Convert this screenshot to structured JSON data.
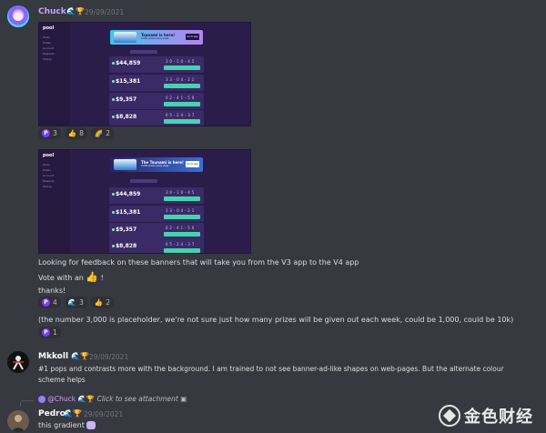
{
  "messages": [
    {
      "username": "Chuck",
      "username_color": "#c9a0ff",
      "badges": "🌊🏆",
      "timestamp": "29/09/2021",
      "screenshots": [
        {
          "app_logo": "pool",
          "nav_items": [
            "Pools",
            "Prizes",
            "Account",
            "Rewards",
            "Voting"
          ],
          "banner_title": "Tsunami is here!",
          "banner_subtitle": "3,000 prizes every week",
          "banner_button": "Go to app",
          "pools": [
            {
              "amount": "$44,859",
              "digits": "3 0 - 1 0 - 4 5"
            },
            {
              "amount": "$15,381",
              "digits": "3 3 - 0 4 - 2 1"
            },
            {
              "amount": "$9,357",
              "digits": "0 2 - 4 1 - 5 0"
            },
            {
              "amount": "$8,828",
              "digits": "0 5 - 2 4 - 3 7"
            }
          ]
        },
        {
          "app_logo": "pool",
          "nav_items": [
            "Pools",
            "Prizes",
            "Account",
            "Rewards",
            "Voting"
          ],
          "banner_title": "The Tsunami is here!",
          "banner_subtitle": "3,000 prizes every week",
          "banner_button": "Go to app",
          "pools": [
            {
              "amount": "$44,859",
              "digits": "3 0 - 1 0 - 4 5"
            },
            {
              "amount": "$15,381",
              "digits": "3 3 - 0 4 - 2 1"
            },
            {
              "amount": "$9,357",
              "digits": "0 2 - 4 1 - 5 0"
            },
            {
              "amount": "$8,828",
              "digits": "0 5 - 2 4 - 3 7"
            }
          ]
        }
      ],
      "reactions_top": [
        {
          "emoji": "P",
          "count": "3"
        },
        {
          "emoji": "👍",
          "count": "8"
        },
        {
          "emoji": "🌈",
          "count": "2"
        }
      ],
      "lines": [
        "Looking for feedback on these banners that will take you from the V3 app to the V4 app",
        "Vote with an",
        "thanks!"
      ],
      "vote_emoji": "👍",
      "vote_suffix": "!",
      "reactions_mid": [
        {
          "emoji": "P",
          "count": "4"
        },
        {
          "emoji": "🌊",
          "count": "3"
        },
        {
          "emoji": "👍",
          "count": "2"
        }
      ],
      "note": "(the number 3,000 is placeholder, we're not sure just how many prizes will be given out each week, could be 1,000, could be 10k)",
      "reactions_note": [
        {
          "emoji": "P",
          "count": "1"
        }
      ]
    },
    {
      "username": "Mkkoll",
      "username_color": "#ffffff",
      "badges": "🌊🏆",
      "timestamp": "29/09/2021",
      "lines": [
        "#1 pops and contrasts more with the background. I am trained to not see banner-ad-like shapes on web-pages. But the alternate colour",
        "scheme helps"
      ]
    },
    {
      "reply_user": "@Chuck",
      "reply_badges": "🌊🏆",
      "reply_text": "Click to see attachment",
      "username": "Pedro",
      "username_color": "#ffffff",
      "badges": "🌊🏆",
      "timestamp": "29/09/2021",
      "lines": [
        "this gradient"
      ]
    }
  ],
  "watermark": "金色财经",
  "colors": {
    "background": "#36393f",
    "reaction_bg": "#2f3136",
    "text": "#dcddde",
    "muted": "#72767d",
    "app_bg": "#2a1d4a",
    "accent": "#46d3b0"
  }
}
